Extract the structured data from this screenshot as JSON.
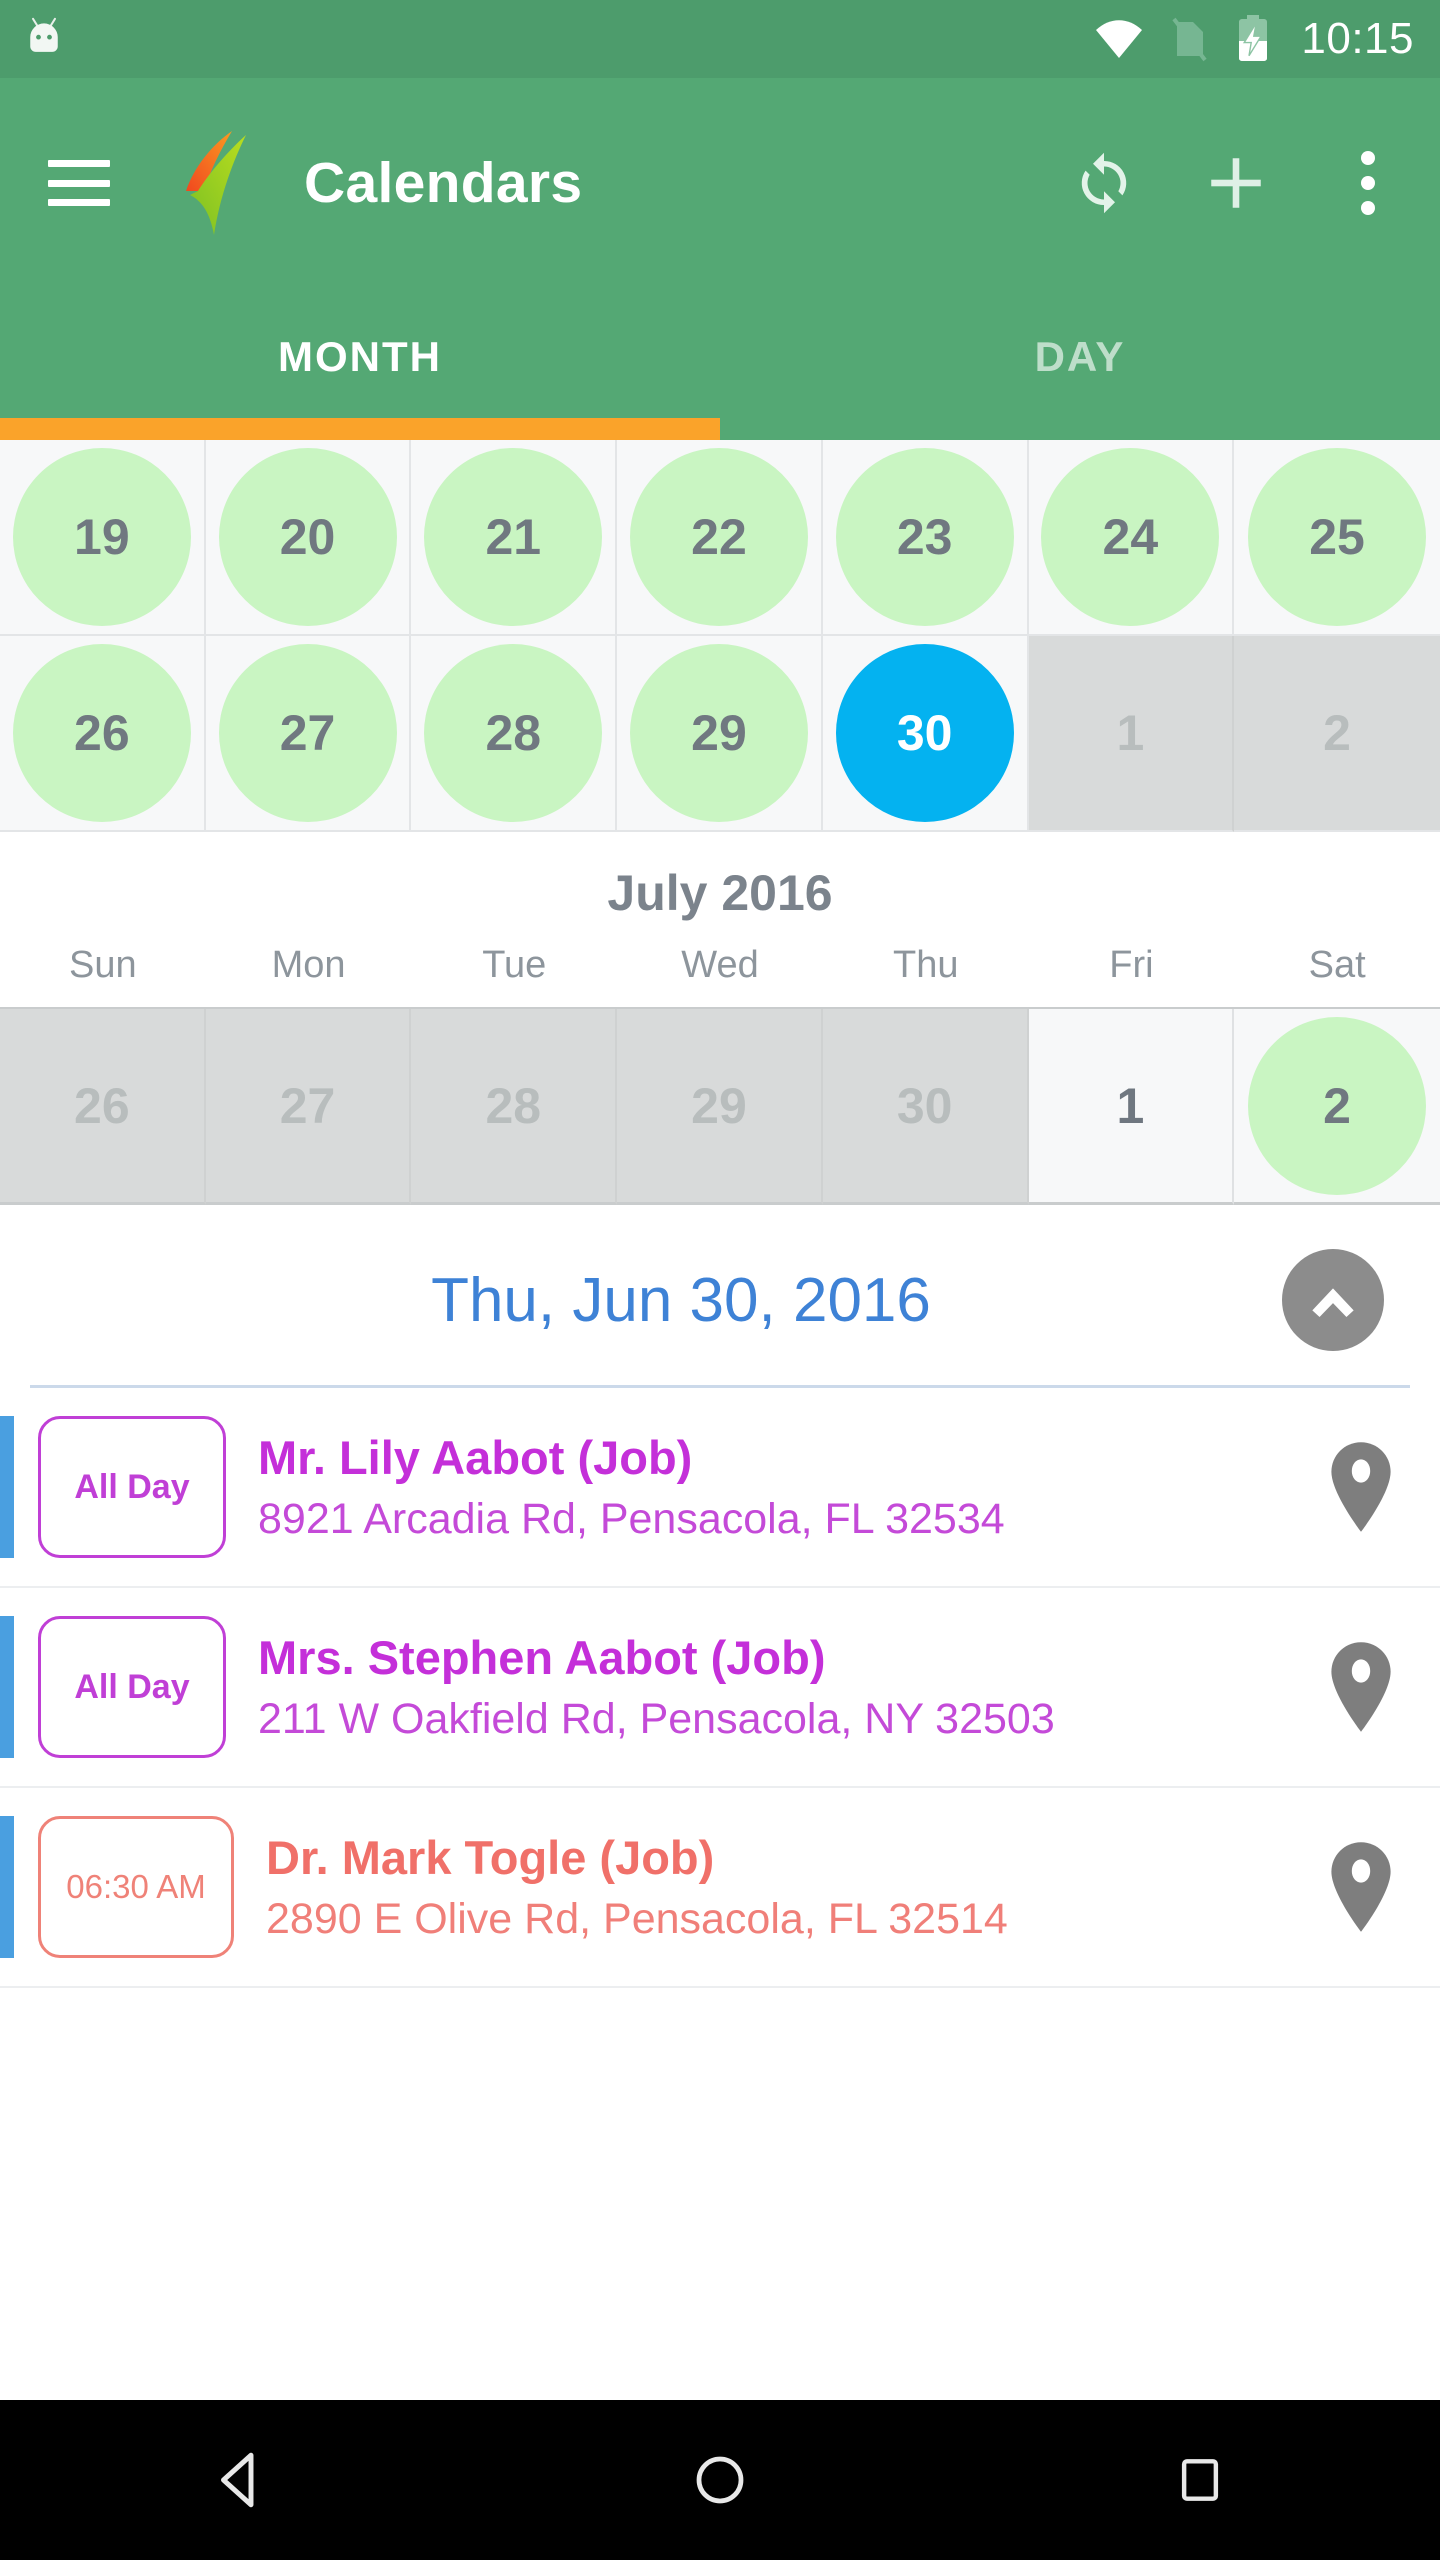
{
  "statusbar": {
    "time": "10:15",
    "icons": [
      "wifi-icon",
      "no-sim-icon",
      "battery-charging-icon"
    ]
  },
  "appbar": {
    "menu_icon": "hamburger-menu-icon",
    "logo_icon": "app-logo-checkmark-icon",
    "title": "Calendars",
    "actions": [
      {
        "name": "refresh-icon",
        "label": "Refresh"
      },
      {
        "name": "add-icon",
        "label": "Add"
      },
      {
        "name": "overflow-menu-icon",
        "label": "More options"
      }
    ]
  },
  "tabs": {
    "items": [
      {
        "label": "MONTH",
        "active": true
      },
      {
        "label": "DAY",
        "active": false
      }
    ],
    "indicator_color": "#faa32a"
  },
  "current_week_rows": [
    [
      {
        "day": "19",
        "state": "green"
      },
      {
        "day": "20",
        "state": "green"
      },
      {
        "day": "21",
        "state": "green"
      },
      {
        "day": "22",
        "state": "green"
      },
      {
        "day": "23",
        "state": "green"
      },
      {
        "day": "24",
        "state": "green"
      },
      {
        "day": "25",
        "state": "green"
      }
    ],
    [
      {
        "day": "26",
        "state": "green"
      },
      {
        "day": "27",
        "state": "green"
      },
      {
        "day": "28",
        "state": "green"
      },
      {
        "day": "29",
        "state": "green"
      },
      {
        "day": "30",
        "state": "today"
      },
      {
        "day": "1",
        "state": "muted"
      },
      {
        "day": "2",
        "state": "muted"
      }
    ]
  ],
  "month": {
    "title": "July 2016",
    "weekdays": [
      "Sun",
      "Mon",
      "Tue",
      "Wed",
      "Thu",
      "Fri",
      "Sat"
    ],
    "preview_row": [
      {
        "day": "26",
        "state": "muted"
      },
      {
        "day": "27",
        "state": "muted"
      },
      {
        "day": "28",
        "state": "muted"
      },
      {
        "day": "29",
        "state": "muted"
      },
      {
        "day": "30",
        "state": "muted"
      },
      {
        "day": "1",
        "state": "plain"
      },
      {
        "day": "2",
        "state": "green"
      }
    ]
  },
  "agenda": {
    "date_label": "Thu, Jun 30, 2016",
    "collapse_icon": "chevron-up-icon",
    "events": [
      {
        "badge": "All Day",
        "badge_type": "allday",
        "title": "Mr. Lily Aabot (Job)",
        "address": "8921 Arcadia Rd, Pensacola, FL 32534",
        "color": "#c42fd9",
        "pin_icon": "location-pin-icon"
      },
      {
        "badge": "All Day",
        "badge_type": "allday",
        "title": "Mrs. Stephen Aabot (Job)",
        "address": "211 W Oakfield Rd, Pensacola, NY 32503",
        "color": "#c42fd9",
        "pin_icon": "location-pin-icon"
      },
      {
        "badge": "06:30 AM",
        "badge_type": "timed",
        "title": "Dr. Mark Togle (Job)",
        "address": "2890 E Olive Rd, Pensacola, FL 32514",
        "color": "#f07069",
        "pin_icon": "location-pin-icon"
      }
    ]
  },
  "navbar": {
    "buttons": [
      {
        "name": "back-button",
        "icon": "back-triangle-icon"
      },
      {
        "name": "home-button",
        "icon": "home-circle-icon"
      },
      {
        "name": "recents-button",
        "icon": "recents-square-icon"
      }
    ]
  },
  "colors": {
    "appbar_green": "#54a874",
    "statusbar_green": "#4d9c6c",
    "tab_indicator_orange": "#faa32a",
    "today_blue": "#04b2f0",
    "event_day_green": "#c9f5c2",
    "agenda_date_blue": "#3e82d6",
    "event_accent_blue": "#4a9fe0"
  }
}
